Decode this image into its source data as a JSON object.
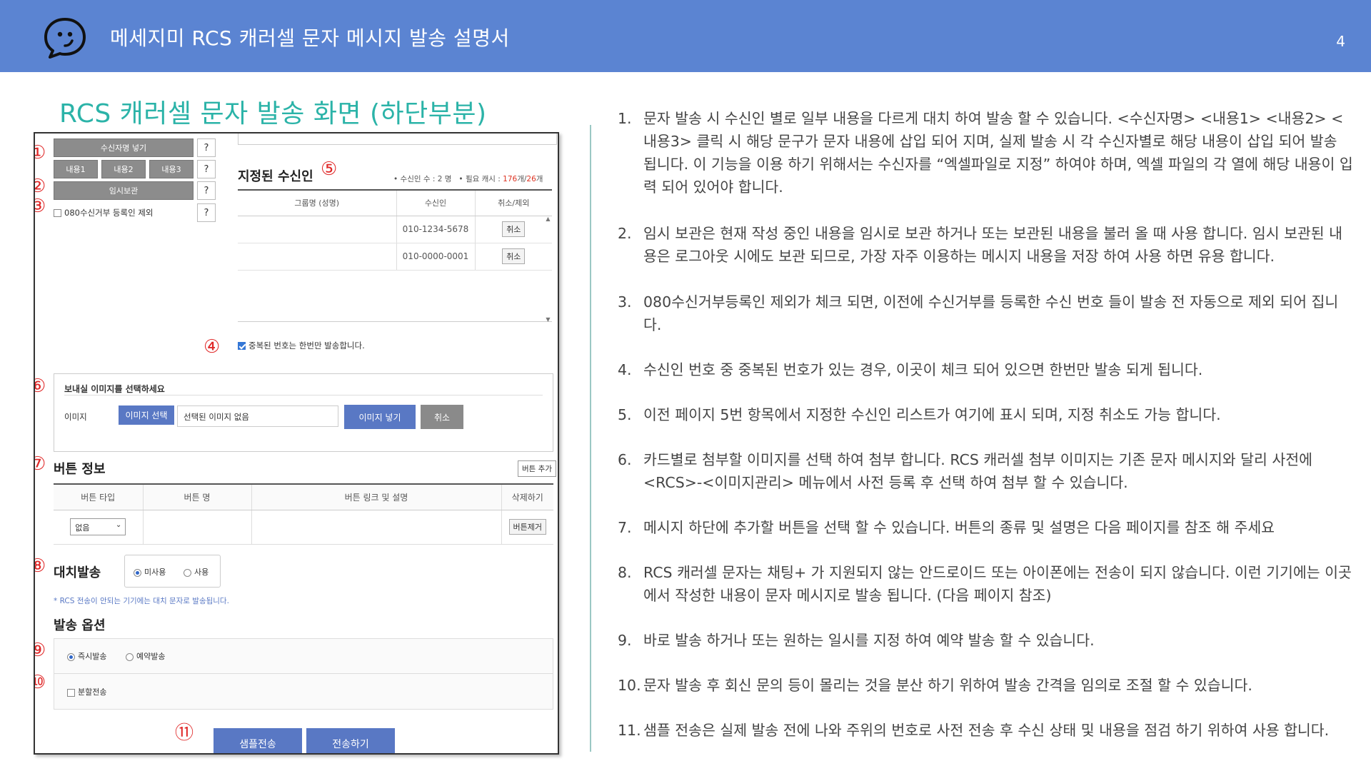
{
  "header": {
    "title": "메세지미 RCS 캐러셀 문자 메시지 발송 설명서",
    "page_number": "4",
    "logo_icon": "chat-bubble-logo-icon"
  },
  "section_title": "RCS 캐러셀 문자 발송 화면 (하단부분)",
  "screenshot": {
    "insert_recipient_name_btn": "수신자명 넣기",
    "content_btns": [
      "내용1",
      "내용2",
      "내용3"
    ],
    "temp_save_btn": "임시보관",
    "help_q": "?",
    "exclude_080_label": "080수신거부 등록인 제외",
    "recipients_title": "지정된 수신인",
    "recipients_summary_a": "• 수신인 수 : 2 명",
    "recipients_summary_b": "• 필요 캐시 :",
    "recipients_summary_cash": "176",
    "recipients_summary_c": "개/",
    "recipients_summary_total": "26",
    "recipients_summary_d": "개",
    "recipients_columns": [
      "그룹명 (성명)",
      "수신인",
      "취소/제외"
    ],
    "recipients_rows": [
      {
        "group": "",
        "number": "010-1234-5678",
        "action": "취소"
      },
      {
        "group": "",
        "number": "010-0000-0001",
        "action": "취소"
      }
    ],
    "dedupe_label": "중복된 번호는 한번만 발송합니다.",
    "image_section_title": "보내실 이미지를 선택하세요",
    "image_label": "이미지",
    "image_select_btn": "이미지 선택",
    "image_selected_text": "선택된 이미지 없음",
    "image_insert_btn": "이미지 넣기",
    "image_cancel_btn": "취소",
    "button_info_title": "버튼 정보",
    "add_button_btn": "버튼 추가",
    "button_columns": [
      "버튼 타입",
      "버튼 명",
      "버튼 링크 및 설명",
      "삭제하기"
    ],
    "button_type_value": "없음",
    "remove_button_btn": "버튼제거",
    "fallback_title": "대치발송",
    "fallback_options": [
      "미사용",
      "사용"
    ],
    "fallback_note": "* RCS 전송이 안되는 기기에는 대치 문자로 발송됩니다.",
    "send_options_title": "발송 옵션",
    "send_now_label": "즉시발송",
    "send_reserve_label": "예약발송",
    "split_send_label": "분할전송",
    "sample_send_btn": "샘플전송",
    "send_btn": "전송하기",
    "markers": [
      "①",
      "②",
      "③",
      "④",
      "⑤",
      "⑥",
      "⑦",
      "⑧",
      "⑨",
      "⑩",
      "⑪"
    ]
  },
  "descriptions": [
    {
      "n": "1.",
      "text": "문자 발송 시 수신인 별로 일부 내용을 다르게 대치 하여 발송 할 수 있습니다. <수신자명> <내용1> <내용2> <내용3> 클릭 시 해당 문구가 문자 내용에 삽입 되어 지며, 실제 발송 시 각 수신자별로 해당 내용이 삽입 되어 발송 됩니다. 이 기능을 이용 하기 위해서는 수신자를 “엑셀파일로 지정” 하여야 하며, 엑셀 파일의 각 열에 해당 내용이 입력 되어 있어야 합니다."
    },
    {
      "n": "2.",
      "text": "임시 보관은 현재 작성 중인 내용을 임시로 보관 하거나 또는 보관된 내용을 불러 올 때 사용 합니다. 임시 보관된 내용은 로그아웃 시에도 보관 되므로, 가장 자주 이용하는 메시지 내용을 저장 하여 사용 하면 유용 합니다."
    },
    {
      "n": "3.",
      "text": "080수신거부등록인 제외가 체크 되면, 이전에 수신거부를 등록한 수신 번호 들이 발송 전 자동으로 제외 되어 집니다."
    },
    {
      "n": "4.",
      "text": "수신인 번호 중 중복된 번호가 있는 경우, 이곳이 체크 되어 있으면 한번만 발송 되게 됩니다."
    },
    {
      "n": "5.",
      "text": "이전 페이지 5번 항목에서 지정한 수신인 리스트가 여기에 표시 되며, 지정 취소도 가능 합니다."
    },
    {
      "n": "6.",
      "text": "카드별로 첨부할 이미지를 선택 하여 첨부 합니다. RCS 캐러셀 첨부 이미지는 기존 문자 메시지와 달리 사전에 <RCS>-<이미지관리> 메뉴에서 사전 등록 후 선택 하여 첨부 할 수 있습니다."
    },
    {
      "n": "7.",
      "text": "메시지 하단에 추가할 버튼을 선택 할 수 있습니다. 버튼의 종류 및 설명은  다음 페이지를 참조 해 주세요"
    },
    {
      "n": "8.",
      "text": "RCS 캐러셀 문자는 채팅+ 가 지원되지 않는 안드로이드 또는 아이폰에는 전송이 되지 않습니다. 이런 기기에는 이곳에서 작성한 내용이 문자 메시지로 발송 됩니다. (다음 페이지 참조)"
    },
    {
      "n": "9.",
      "text": "바로 발송 하거나 또는 원하는 일시를 지정 하여 예약 발송 할 수 있습니다."
    },
    {
      "n": "10.",
      "text": "문자 발송 후 회신 문의 등이 몰리는 것을 분산 하기 위하여 발송 간격을 임의로 조절 할 수 있습니다."
    },
    {
      "n": "11.",
      "text": "샘플 전송은 실제 발송 전에 나와 주위의 번호로 사전 전송 후 수신 상태 및 내용을 점검 하기 위하여 사용 합니다."
    }
  ],
  "colors": {
    "header_bg": "#5b84d2",
    "section_title": "#2bb3a8",
    "marker_red": "#e02828",
    "button_blue": "#5978c4"
  }
}
